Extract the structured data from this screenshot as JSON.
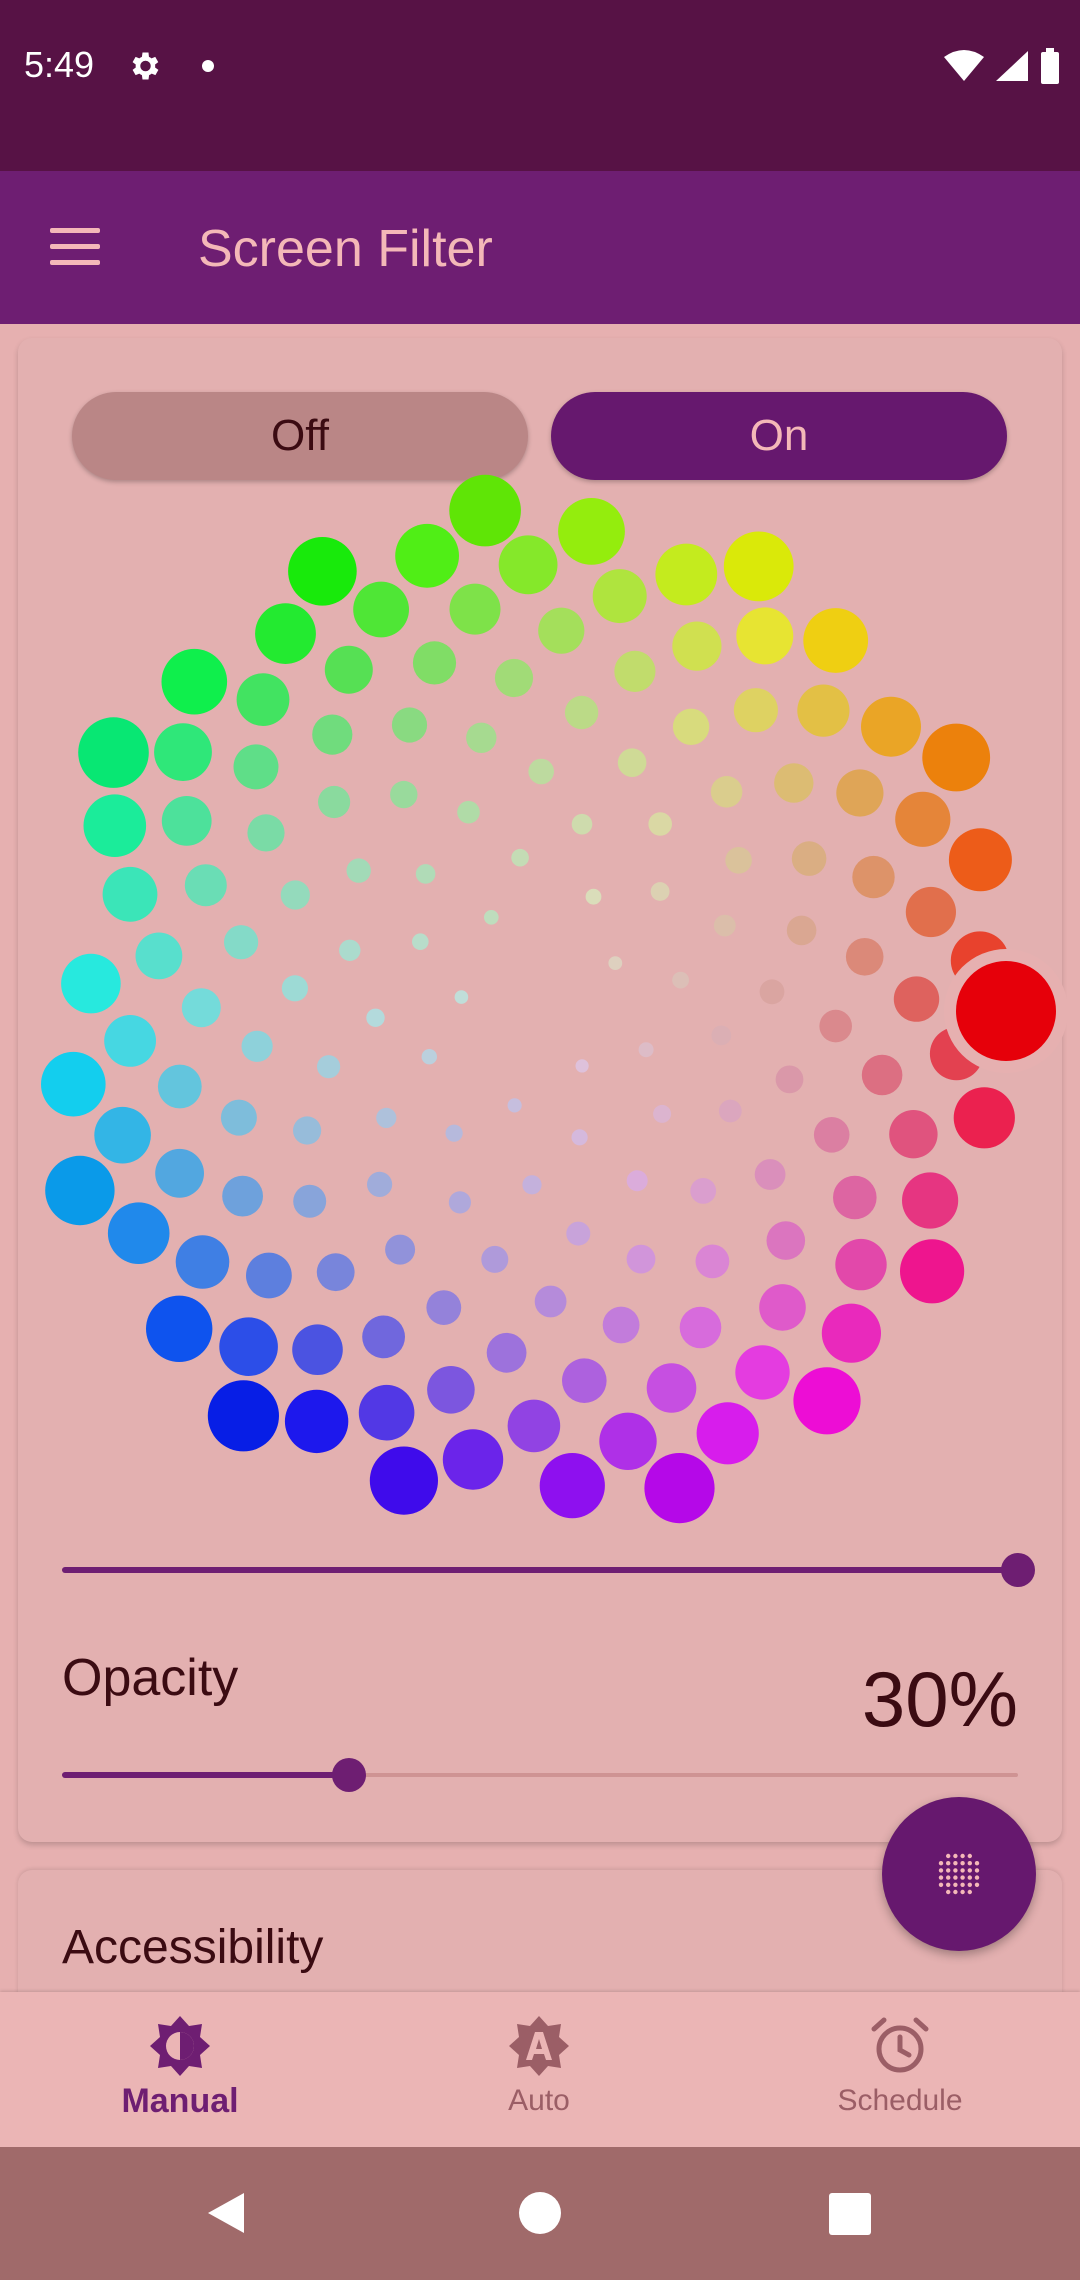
{
  "status_bar": {
    "time": "5:49",
    "icons": [
      "gear-icon",
      "dot-icon",
      "wifi-icon",
      "signal-icon",
      "battery-icon"
    ]
  },
  "app_bar": {
    "title": "Screen Filter",
    "menu_icon": "hamburger-menu-icon"
  },
  "toggle": {
    "off_label": "Off",
    "on_label": "On",
    "selected": "On"
  },
  "color_wheel": {
    "selected_color": "red",
    "selected_hex": "#e6000a"
  },
  "temperature_slider": {
    "value": 1.0
  },
  "opacity": {
    "label": "Opacity",
    "value_text": "30%",
    "value": 0.3
  },
  "accessibility": {
    "label": "Accessibility"
  },
  "fab": {
    "icon": "dot-grid-icon"
  },
  "bottom_nav": {
    "items": [
      {
        "label": "Manual",
        "icon": "brightness-icon",
        "active": true
      },
      {
        "label": "Auto",
        "icon": "auto-brightness-icon",
        "active": false
      },
      {
        "label": "Schedule",
        "icon": "alarm-icon",
        "active": false
      }
    ]
  },
  "colors": {
    "status_bar": "#571245",
    "app_bar": "#6e1e72",
    "accent": "#66186e",
    "background": "#e6b0b0",
    "title": "#f4b8b8"
  }
}
